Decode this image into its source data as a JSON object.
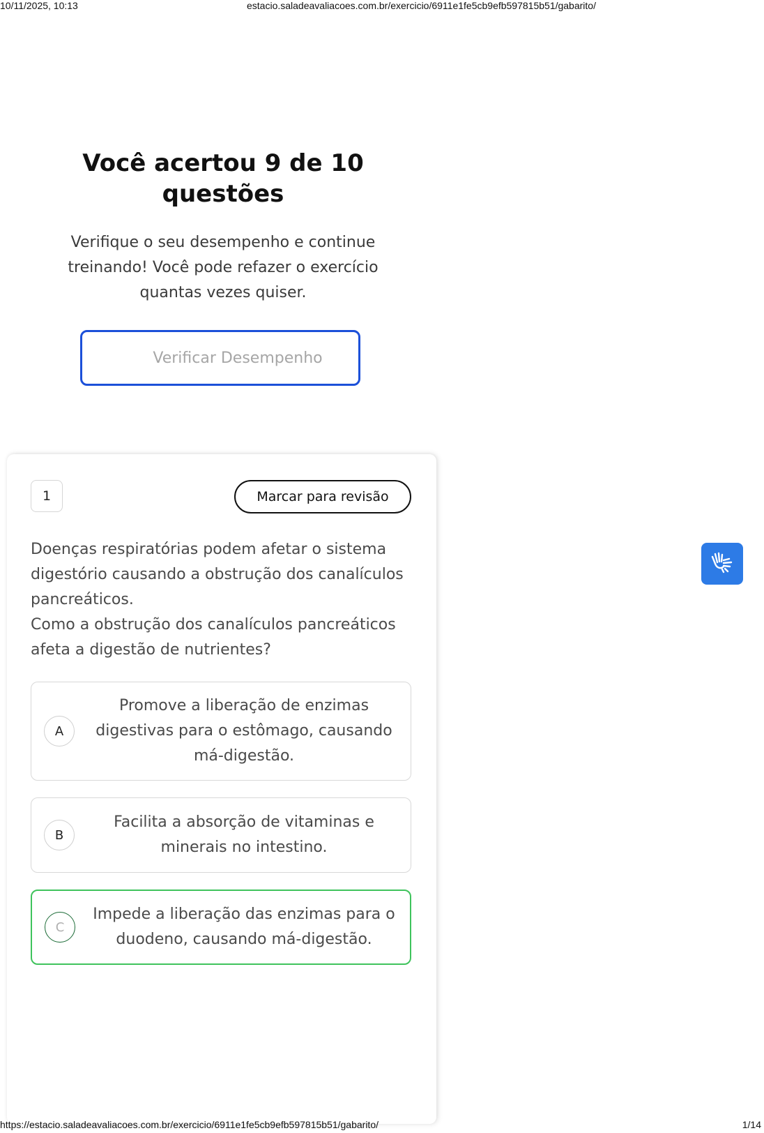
{
  "print_header": {
    "datetime": "10/11/2025, 10:13",
    "url": "estacio.saladeavaliacoes.com.br/exercicio/6911e1fe5cb9efb597815b51/gabarito/"
  },
  "print_footer": {
    "url": "https://estacio.saladeavaliacoes.com.br/exercicio/6911e1fe5cb9efb597815b51/gabarito/",
    "page": "1/14"
  },
  "result": {
    "title": "Você acertou 9 de 10 questões",
    "subtitle": "Verifique o seu desempenho e continue treinando! Você pode refazer o exercício quantas vezes quiser.",
    "verify_button_label": "Verificar Desempenho"
  },
  "question": {
    "number": "1",
    "mark_review_label": "Marcar para revisão",
    "statement": [
      "Doenças respiratórias podem afetar o sistema digestório causando a obstrução dos canalículos pancreáticos.",
      "Como a obstrução dos canalículos pancreáticos afeta a digestão de nutrientes?"
    ],
    "options": [
      {
        "letter": "A",
        "text": "Promove a liberação de enzimas digestivas para o estômago, causando má-digestão.",
        "state": "neutral"
      },
      {
        "letter": "B",
        "text": "Facilita a absorção de vitaminas e minerais no intestino.",
        "state": "neutral"
      },
      {
        "letter": "C",
        "text": "Impede a liberação das enzimas para o duodeno, causando má-digestão.",
        "state": "correct"
      }
    ]
  },
  "accessibility_widget": {
    "icon": "sign-language-hands-icon",
    "color": "#2d7be6"
  },
  "colors": {
    "accent_blue": "#1c50d9",
    "correct_green": "#3fc35c"
  }
}
